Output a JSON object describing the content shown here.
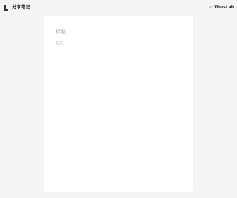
{
  "header": {
    "logo_icon": "app-logo-icon",
    "app_title": "分享笔记",
    "brand_prefix": "by",
    "brand_name": "ThusLab"
  },
  "editor": {
    "title_placeholder": "标题",
    "body_placeholder": "正文"
  }
}
